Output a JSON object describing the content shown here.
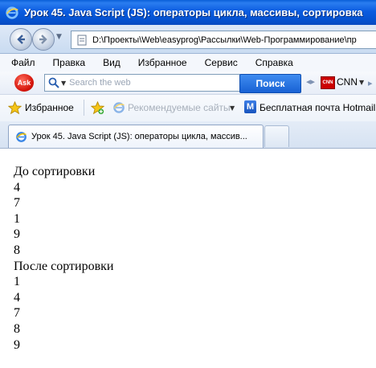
{
  "window": {
    "title": "Урок 45. Java Script (JS): операторы цикла, массивы, сортировка"
  },
  "address_bar": {
    "url": "D:\\Проекты\\Web\\easyprog\\Рассылки\\Web-Программирование\\пр"
  },
  "menu": {
    "items": [
      "Файл",
      "Правка",
      "Вид",
      "Избранное",
      "Сервис",
      "Справка"
    ]
  },
  "toolbar": {
    "ask_logo_text": "Ask",
    "search_placeholder": "Search the web",
    "search_button": "Поиск",
    "cnn_badge": "CNN",
    "cnn_label": "CNN"
  },
  "favorites_bar": {
    "favorites_label": "Избранное",
    "recommended_sites": "Рекомендуемые сайты",
    "hotmail_icon_letter": "M",
    "hotmail_label": "Бесплатная почта Hotmail"
  },
  "tabs": {
    "active_label": "Урок 45. Java Script (JS): операторы цикла, массив..."
  },
  "content": {
    "before_heading": "До сортировки",
    "before_values": [
      "4",
      "7",
      "1",
      "9",
      "8"
    ],
    "after_heading": "После сортировки",
    "after_values": [
      "1",
      "4",
      "7",
      "8",
      "9"
    ]
  },
  "icons": {
    "title_icon": "ie-logo-icon",
    "back": "back-arrow-icon",
    "forward": "forward-arrow-icon",
    "address": "page-icon",
    "search": "search-magnifier-icon",
    "favorites": "star-icon",
    "add_favorites": "add-favorite-star-icon",
    "recommended": "ie-logo-icon",
    "hotmail": "hotmail-icon",
    "tab": "ie-logo-icon"
  },
  "colors": {
    "titlebar": "#0b5ce0",
    "search_button": "#1861d4",
    "ask_logo": "#d4140a"
  }
}
